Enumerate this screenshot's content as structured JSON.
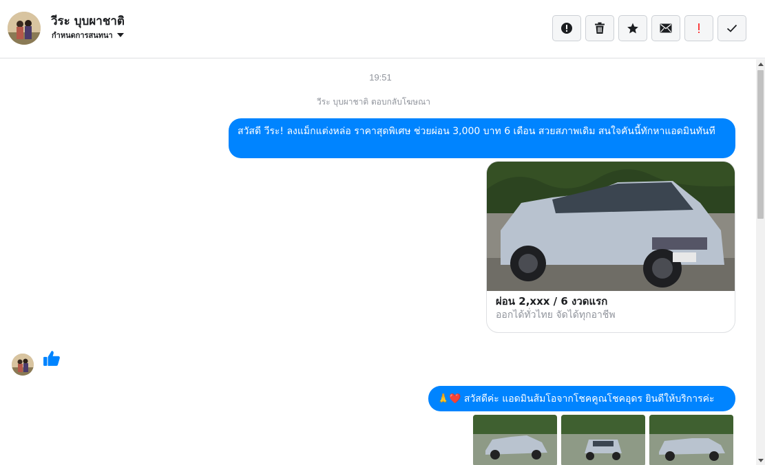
{
  "header": {
    "contact_name": "วีระ บุบผาชาติ",
    "conversation_settings": "กำหนดการสนทนา",
    "toolbar": [
      {
        "icon": "exclamation-circle-icon"
      },
      {
        "icon": "trash-icon"
      },
      {
        "icon": "star-icon"
      },
      {
        "icon": "envelope-icon"
      },
      {
        "icon": "priority-exclamation-icon"
      },
      {
        "icon": "checkmark-icon"
      }
    ]
  },
  "thread": {
    "timestamp": "19:51",
    "ad_reply_note": "วีระ บุบผาชาติ ตอบกลับโฆษณา",
    "messages": [
      {
        "text": "สวัสดี วีระ! ลงแม็กแต่งหล่อ ราคาสุดพิเศษ ช่วยผ่อน 3,000 บาท 6 เดือน สวยสภาพเดิม สนใจคันนี้ทักหาแอดมินทันที"
      },
      {
        "card_title": "ผ่อน 2,xxx / 6 งวดแรก",
        "card_subtitle": "ออกได้ทั่วไทย จัดได้ทุกอาชีพ"
      },
      {
        "reply": "like",
        "icon": "thumbs-up-icon"
      },
      {
        "emoji": "🙏❤️",
        "text": "สวัสดีค่ะ แอดมินส้มโอจากโชคคูณโชคอุดร ยินดีให้บริการค่ะ"
      }
    ]
  },
  "colors": {
    "accent": "#0084ff",
    "muted_text": "#90949c",
    "border": "#dddfe2",
    "alert_red": "#fa3e3e"
  }
}
